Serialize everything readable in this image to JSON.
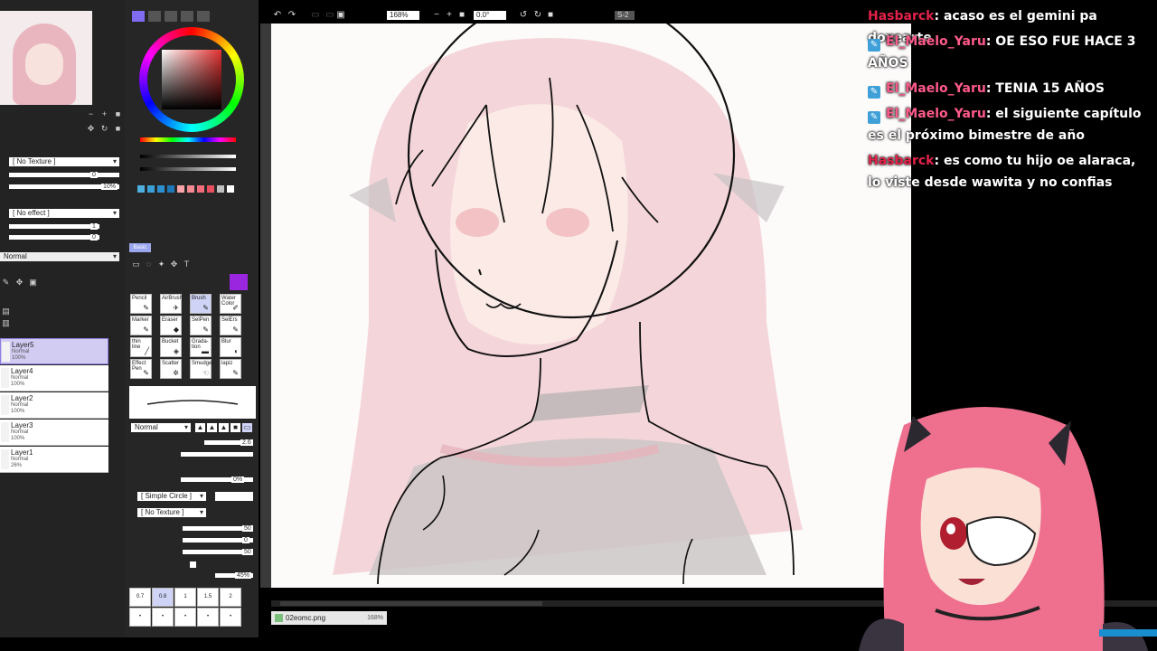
{
  "left_panel": {
    "texture": "[ No Texture ]",
    "texture_value": "0",
    "texture_percent": "10%",
    "effect": "[ No effect ]",
    "effect_value1": "1",
    "effect_value2": "0",
    "blend_mode": "Normal",
    "layers": [
      {
        "name": "Layer5",
        "mode": "Normal",
        "opacity": "100%",
        "selected": true
      },
      {
        "name": "Layer4",
        "mode": "Normal",
        "opacity": "100%",
        "selected": false
      },
      {
        "name": "Layer2",
        "mode": "Normal",
        "opacity": "100%",
        "selected": false
      },
      {
        "name": "Layer3",
        "mode": "Normal",
        "opacity": "100%",
        "selected": false
      },
      {
        "name": "Layer1",
        "mode": "Normal",
        "opacity": "26%",
        "selected": false
      }
    ]
  },
  "tool_panel": {
    "tab_basic": "Basic",
    "tools": [
      {
        "label": "Pencil",
        "icon": "pencil-icon"
      },
      {
        "label": "AirBrush",
        "icon": "airbrush-icon"
      },
      {
        "label": "Brush",
        "icon": "brush-icon"
      },
      {
        "label": "Water Color",
        "icon": "watercolor-icon"
      },
      {
        "label": "Marker",
        "icon": "marker-icon"
      },
      {
        "label": "Eraser",
        "icon": "eraser-icon"
      },
      {
        "label": "SelPen",
        "icon": "selpen-icon"
      },
      {
        "label": "SelErs",
        "icon": "selers-icon"
      },
      {
        "label": "thin line",
        "icon": "thin-line-icon"
      },
      {
        "label": "Bucket",
        "icon": "bucket-icon"
      },
      {
        "label": "Grada-tion",
        "icon": "gradation-icon"
      },
      {
        "label": "Blur",
        "icon": "blur-icon"
      },
      {
        "label": "Effect Pen",
        "icon": "effect-pen-icon"
      },
      {
        "label": "Scatter",
        "icon": "scatter-icon"
      },
      {
        "label": "Smudge",
        "icon": "smudge-icon"
      },
      {
        "label": "lapiz",
        "icon": "lapiz-icon"
      }
    ],
    "active_tool": "Brush",
    "blend_mode": "Normal",
    "brush_size_value": "2.6",
    "min_size_value": "0%",
    "shape": "[ Simple Circle ]",
    "texture": "[ No Texture ]",
    "blending_value": "50",
    "dilution_value": "0",
    "persistence_value": "50",
    "pressure_value": "45%",
    "size_presets": [
      "0.7",
      "0.8",
      "1",
      "1.5",
      "2"
    ],
    "active_size": "0.8",
    "swatch_colors": [
      "#4fb0e0",
      "#3aa0d8",
      "#2e8fcf",
      "#1e78b8",
      "#f7a3a8",
      "#f58a93",
      "#ef6e7a",
      "#e8505f",
      "#c0c0c0",
      "#ffffff"
    ],
    "accent_color": "#9b26e0"
  },
  "toolbar": {
    "zoom": "168%",
    "rotation": "0.0°",
    "stabilizer": "S-2"
  },
  "document_tab": {
    "filename": "02eomc.png",
    "zoom": "168%"
  },
  "chat": [
    {
      "user": "Hasbarck",
      "user_color": "#e3224a",
      "badge": false,
      "text": ": acaso es el gemini pa doxearte"
    },
    {
      "user": "El_Maelo_Yaru",
      "user_color": "#ff5a8a",
      "badge": true,
      "text": ": OE ESO FUE HACE 3 AÑOS"
    },
    {
      "user": "El_Maelo_Yaru",
      "user_color": "#ff5a8a",
      "badge": true,
      "text": ": TENIA 15 AÑOS"
    },
    {
      "user": "El_Maelo_Yaru",
      "user_color": "#ff5a8a",
      "badge": true,
      "text": ": el siguiente capítulo es el próximo bimestre de año"
    },
    {
      "user": "Hasbarck",
      "user_color": "#e3224a",
      "badge": false,
      "text": ": es como tu hijo oe alaraca, lo viste desde wawita y no confias"
    }
  ]
}
